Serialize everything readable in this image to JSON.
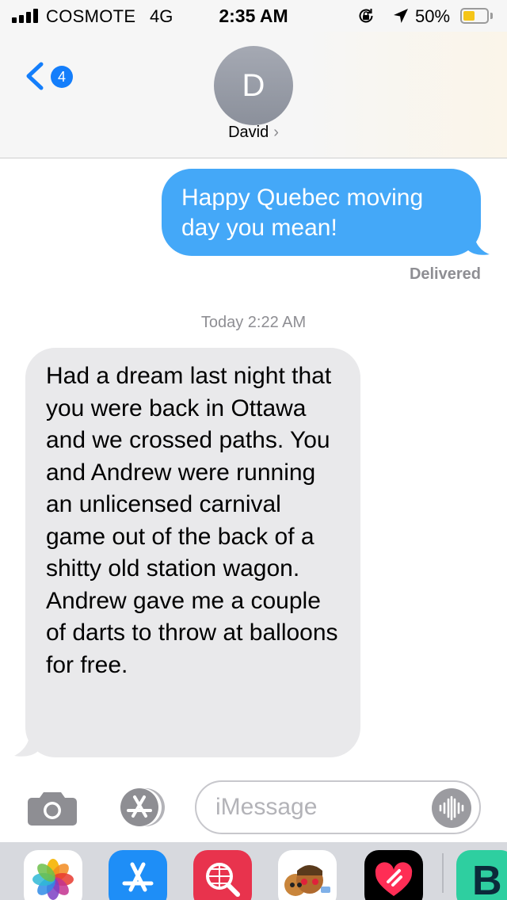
{
  "status_bar": {
    "carrier": "COSMOTE",
    "network": "4G",
    "time": "2:35 AM",
    "battery_percent": "50%",
    "battery_level": 0.5,
    "signal_bars": 4,
    "icons": [
      "signal-icon",
      "rotation-lock-icon",
      "location-arrow-icon",
      "battery-icon"
    ]
  },
  "header": {
    "back_badge_count": "4",
    "avatar_initial": "D",
    "contact_name": "David",
    "contact_chevron": "›"
  },
  "conversation": {
    "outgoing": {
      "text": "Happy Quebec moving day you mean!",
      "status": "Delivered"
    },
    "timestamp": {
      "day": "Today",
      "time": "2:22 AM"
    },
    "incoming": {
      "text": "Had a dream last night that you were back in Ottawa and we crossed paths. You and Andrew were running an unlicensed carnival game out of the back of a shitty old station wagon. Andrew gave me a couple of darts to throw at balloons for free."
    }
  },
  "composer": {
    "placeholder": "iMessage",
    "icons": [
      "camera-icon",
      "app-store-icon",
      "audio-waveform-icon"
    ]
  },
  "app_drawer": {
    "apps": [
      "photos-app-icon",
      "app-store-app-icon",
      "web-search-app-icon",
      "memoji-app-icon",
      "heart-app-icon",
      "b-app-icon"
    ],
    "b_app_letter": "B"
  },
  "colors": {
    "outgoing_bubble": "#44a8f8",
    "incoming_bubble": "#e9e9eb",
    "ios_blue": "#147efb",
    "battery_fill": "#f5c518",
    "secondary_text": "#8e8e93"
  }
}
